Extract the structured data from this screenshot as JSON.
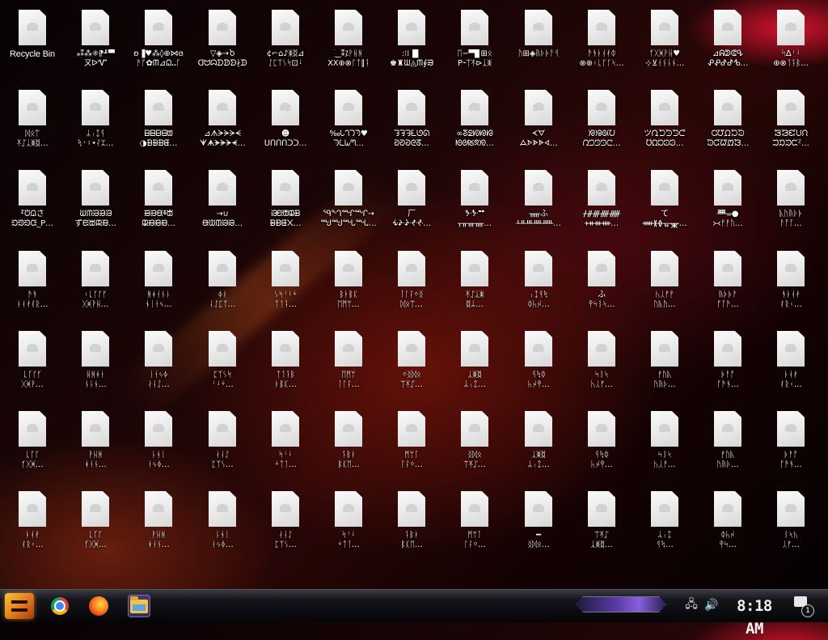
{
  "desktop": {
    "recycle_bin_label": "Recycle Bin",
    "file_labels": [
      [
        "⁎⁑⁂⁜⁋╜▀",
        "ㄡᐅᏉ"
      ],
      [
        "ʚ▐♥⁂◊⊕⋈ɞ",
        "ᚫᚩ✿ᙏ⊿ᙉ᎑ᚴ"
      ],
      [
        "▽◈→Ⴆ",
        "ᗡᗢᗣᗤᗥᗦ∤ᗬ"
      ],
      [
        "¢⌐⌂♪ᛤᛥ⊿",
        "ᛇᛈᛉᛊᛋ⊡ᛍ"
      ],
      [
        "⁐⁑⁒ᚹᚺᚻ",
        "XX⊕⊗ᚵᛏ∥ᛑ"
      ],
      [
        ":⁝⁞▐▌",
        "♚♜ᙎ◬ᙏ∮ᙑ"
      ],
      [
        "ᛖ∽▀▊⊞ᛟ",
        "P⁃ᛠᛡ⊳ᛣᛤ"
      ],
      [
        "ᚤ⊞◈ᚥᚦᚧᚨᛩ",
        ""
      ],
      [
        "ᚫᚬᚭᚮᚯᛰ",
        "⊗⊕ᚲᚳᚴᚵᛶ…"
      ],
      [
        "ᚶᚷᚸᚹᚺ♥",
        "⊹⊻ᚽᚾᚿᛀ…"
      ],
      [
        "⊿ᕱᕲᕳᕴ",
        "ᕵᕶᕷᕸᕹ…"
      ],
      [
        "ᛋ∆ᛌᛍ",
        "⊕⊗ᛐᛑᛒ…"
      ],
      [
        "ᛞᛟᛠ",
        "ᛡᛢᛣᛤᛥ…"
      ],
      [
        "ᛦᛧᛨᛩ",
        "ᛪ᛫᛬᛭ᛮᛯ…"
      ],
      [
        "ᗷᗸᗹᗺᗻ",
        "◑ᗽᗾᗿᘀ…"
      ],
      [
        "⊿ᗑᗒᗓᗔᗕ",
        "ᗖᗗᗘᗙᗚᗛ…"
      ],
      [
        "☻",
        "ᑌᑍᑎᑏᑐᑑ…"
      ],
      [
        "‰ᘂᘃᘄᘅ♥",
        "ᘆᘇᘈᘉ…"
      ],
      [
        "ᘊᘋᘌᘍᘎᘏ",
        "ᘐᘑᘒᘓᘔ…"
      ],
      [
        "∞ᘕᘖᘗᘘᘙ",
        "ᘚᘛᘜᘝᘞ…"
      ],
      [
        "ᗉᗊ",
        "ᗋᗌᗍᗎᗏ…"
      ],
      [
        "ᘟᘠᘡᘢ",
        "ᘣᘤᘥᘦᘧ…"
      ],
      [
        "ツᘩᘪᘫᘬᘭ",
        "ᘮᘯᘰᘱᘲ…"
      ],
      [
        "ᘳᘴᘵᘶᘷ",
        "ᘸᘹᘺᘻᘼ…"
      ],
      [
        "ᘽᘾᘿᙀᙁ",
        "ᙂᙃᙄᙅᙆ…"
      ],
      [
        "ᙇᙈᙉさ",
        "ᙊᙋᙌᙍ_P…"
      ],
      [
        "ᙎᙏᙐᙑᙒ",
        "ずᙓᙔᙕᙖ…"
      ],
      [
        "ᙗᙘᙙᙚᙛ",
        "ᙜᙝᙞᙟ…"
      ],
      [
        "→∪",
        "ᙠᙡᙢᙣᙤ…"
      ],
      [
        "ᙥᙦᙧᙨᙩ",
        "ᙪᙫᙬ᙭…"
      ],
      [
        "ᙯᙰᙱᙲ→",
        "ᙳᙴᙵᙶ…"
      ],
      [
        "厂",
        "ᙷᙸᙹᙺᙻ…"
      ],
      [
        "ᙼᙽᙾᙿ",
        "ᚁᚂᚃᚄ…"
      ],
      [
        "ᚅふ",
        "ᚆᚇᚈᚉᚊ…"
      ],
      [
        "ᚋᚌᚍᚎᚏ",
        "ᚐᚑᚒᚓ…"
      ],
      [
        "て",
        "ᚔᚕᚖᚗᚘ…"
      ],
      [
        "ᚙᚚ●",
        "᚛᚜ᚠᚡᚢ…"
      ],
      [
        "ᚣᚤᚥᚦᚧ",
        "ᚨᚩᚪ…"
      ],
      [
        "ᚫᚬ",
        "ᚭᚮᚯᚰᚱ…"
      ],
      [
        "ᚲᚳᚴᚵᚶ",
        "ᚷᚸᚹᚺ…"
      ],
      [
        "ᚻᚼᚽᚾᚿ",
        "ᛀᛁᛂᛃ…"
      ],
      [
        "ᛄᛅ",
        "ᛆᛇᛈᛉ…"
      ],
      [
        "ᛊᛋᛌᛍᛎ",
        "ᛏᛐᛑ…"
      ],
      [
        "ᛒᛓᛔᛕ",
        "ᛖᛗᛘ…"
      ],
      [
        "ᛙᛚᛛᛜᛝ",
        "ᛞᛟᛠ…"
      ],
      [
        "ᛡᛢᛣᛤ",
        "ᛥᛦ…"
      ],
      [
        "ᛧᛨᛩᛪ",
        "ᛰᛱᛲ…"
      ],
      [
        "ふ",
        "ᛳᛴᛵᛶ…"
      ],
      [
        "ᛷᛸᚠᚡ",
        "ᚢᚣᚤ…"
      ],
      [
        "ᚥᚦᚧᚨ",
        "ᚩᚪᚫ…"
      ],
      [
        "ᚬᚭᚮᚯ",
        "ᚰᚱᚲ…"
      ],
      [
        "ᚳᚴᚵᚶ",
        "ᚷᚸᚹ…"
      ],
      [
        "ᚺᚻᚼᚽ",
        "ᚾᚿᛀ…"
      ],
      [
        "ᛁᛂᛃᛄ",
        "ᛅᛆᛇ…"
      ],
      [
        "ᛈᛉᛊᛋ",
        "ᛌᛍᛎ…"
      ],
      [
        "ᛏᛐᛑᛒ",
        "ᛓᛔᛕ…"
      ],
      [
        "ᛖᛗᛘ",
        "ᛙᛚᛛ…"
      ],
      [
        "ᛜᛝᛞᛟ",
        "ᛠᛡᛢ…"
      ],
      [
        "ᛣᛤᛥ",
        "ᛦᛧᛨ…"
      ],
      [
        "ᛩᛪᛰ",
        "ᛱᛲᛳ…"
      ],
      [
        "ᛴᛵᛶ",
        "ᛷᛸᚠ…"
      ],
      [
        "ᚡᚢᚣ",
        "ᚤᚥᚦ…"
      ],
      [
        "ᚧᚨᚩ",
        "ᚪᚫᚬ…"
      ],
      [
        "ᚭᚮᚯ",
        "ᚰᚱᚲ…"
      ],
      [
        "ᚳᚴᚵ",
        "ᚶᚷᚸ…"
      ],
      [
        "ᚹᚺᚻ",
        "ᚼᚽᚾ…"
      ],
      [
        "ᚿᛀᛁ",
        "ᛂᛃᛄ…"
      ],
      [
        "ᛅᛆᛇ",
        "ᛈᛉᛊ…"
      ],
      [
        "ᛋᛌᛍ",
        "ᛎᛏᛐ…"
      ],
      [
        "ᛑᛒᛓ",
        "ᛔᛕᛖ…"
      ],
      [
        "ᛗᛘᛙ",
        "ᛚᛛᛜ…"
      ],
      [
        "ᛝᛞᛟ",
        "ᛠᛡᛢ…"
      ],
      [
        "ᛣᛤᛥ",
        "ᛦᛧᛨ…"
      ],
      [
        "ᛩᛪᛰ",
        "ᛱᛲᛳ…"
      ],
      [
        "ᛴᛵᛶ",
        "ᛷᛸᚠ…"
      ],
      [
        "ᚡᚢᚣ",
        "ᚤᚥᚦ…"
      ],
      [
        "ᚧᚨᚩ",
        "ᚪᚫᚬ…"
      ],
      [
        "ᚭᚮᚯ",
        "ᚰᚱᚲ…"
      ],
      [
        "ᚳᚴᚵ",
        "ᚶᚷᚸ…"
      ],
      [
        "ᚹᚺᚻ",
        "ᚼᚽᚾ…"
      ],
      [
        "ᚿᛀᛁ",
        "ᛂᛃᛄ…"
      ],
      [
        "ᛅᛆᛇ",
        "ᛈᛉᛊ…"
      ],
      [
        "ᛋᛌᛍ",
        "ᛎᛏᛐ…"
      ],
      [
        "ᛑᛒᛓ",
        "ᛔᛕᛖ…"
      ],
      [
        "ᛗᛘᛙ",
        "ᛚᛛᛜ…"
      ],
      [
        "━",
        "ᛝᛞᛟ…"
      ],
      [
        "ᛠᛡᛢ",
        "ᛣᛤᛥ…"
      ],
      [
        "ᛦᛧᛨ",
        "ᛩᛪ…"
      ],
      [
        "ᛰᛱᛲ",
        "ᛳᛴ…"
      ],
      [
        "ᛵᛶᛷ",
        "ᛸᚠ…"
      ]
    ]
  },
  "taskbar": {
    "apps": [
      {
        "name": "start-button"
      },
      {
        "name": "chrome-icon"
      },
      {
        "name": "firefox-icon"
      },
      {
        "name": "file-explorer-icon"
      }
    ],
    "clock": "8:18 AM",
    "notification_count": "1",
    "accent": "#7b4fd0"
  }
}
